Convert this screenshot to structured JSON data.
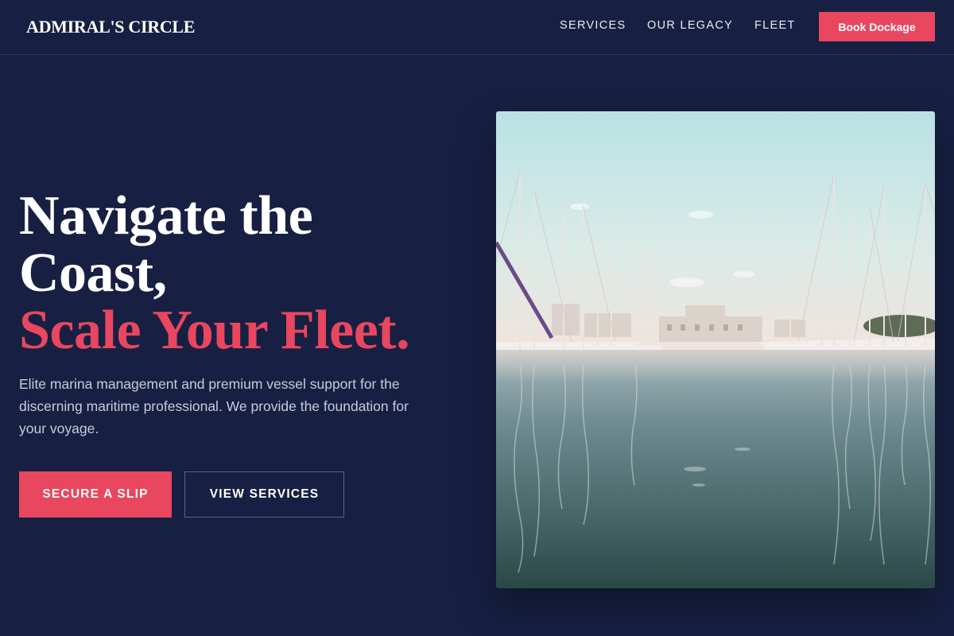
{
  "brand": {
    "name": "ADMIRAL'S CIRCLE"
  },
  "nav": {
    "items": [
      {
        "label": "SERVICES"
      },
      {
        "label": "OUR LEGACY"
      },
      {
        "label": "FLEET"
      }
    ],
    "cta_label": "Book Dockage"
  },
  "hero": {
    "title_line1": "Navigate the",
    "title_line2": "Coast,",
    "title_accent": "Scale Your Fleet.",
    "subtitle": "Elite marina management and premium vessel support for the discerning maritime professional. We provide the foundation for your voyage.",
    "primary_cta": "SECURE A SLIP",
    "secondary_cta": "VIEW SERVICES"
  },
  "colors": {
    "background": "#172042",
    "accent": "#e8475f",
    "text": "#ffffff",
    "muted_text": "#c7ccdb"
  }
}
